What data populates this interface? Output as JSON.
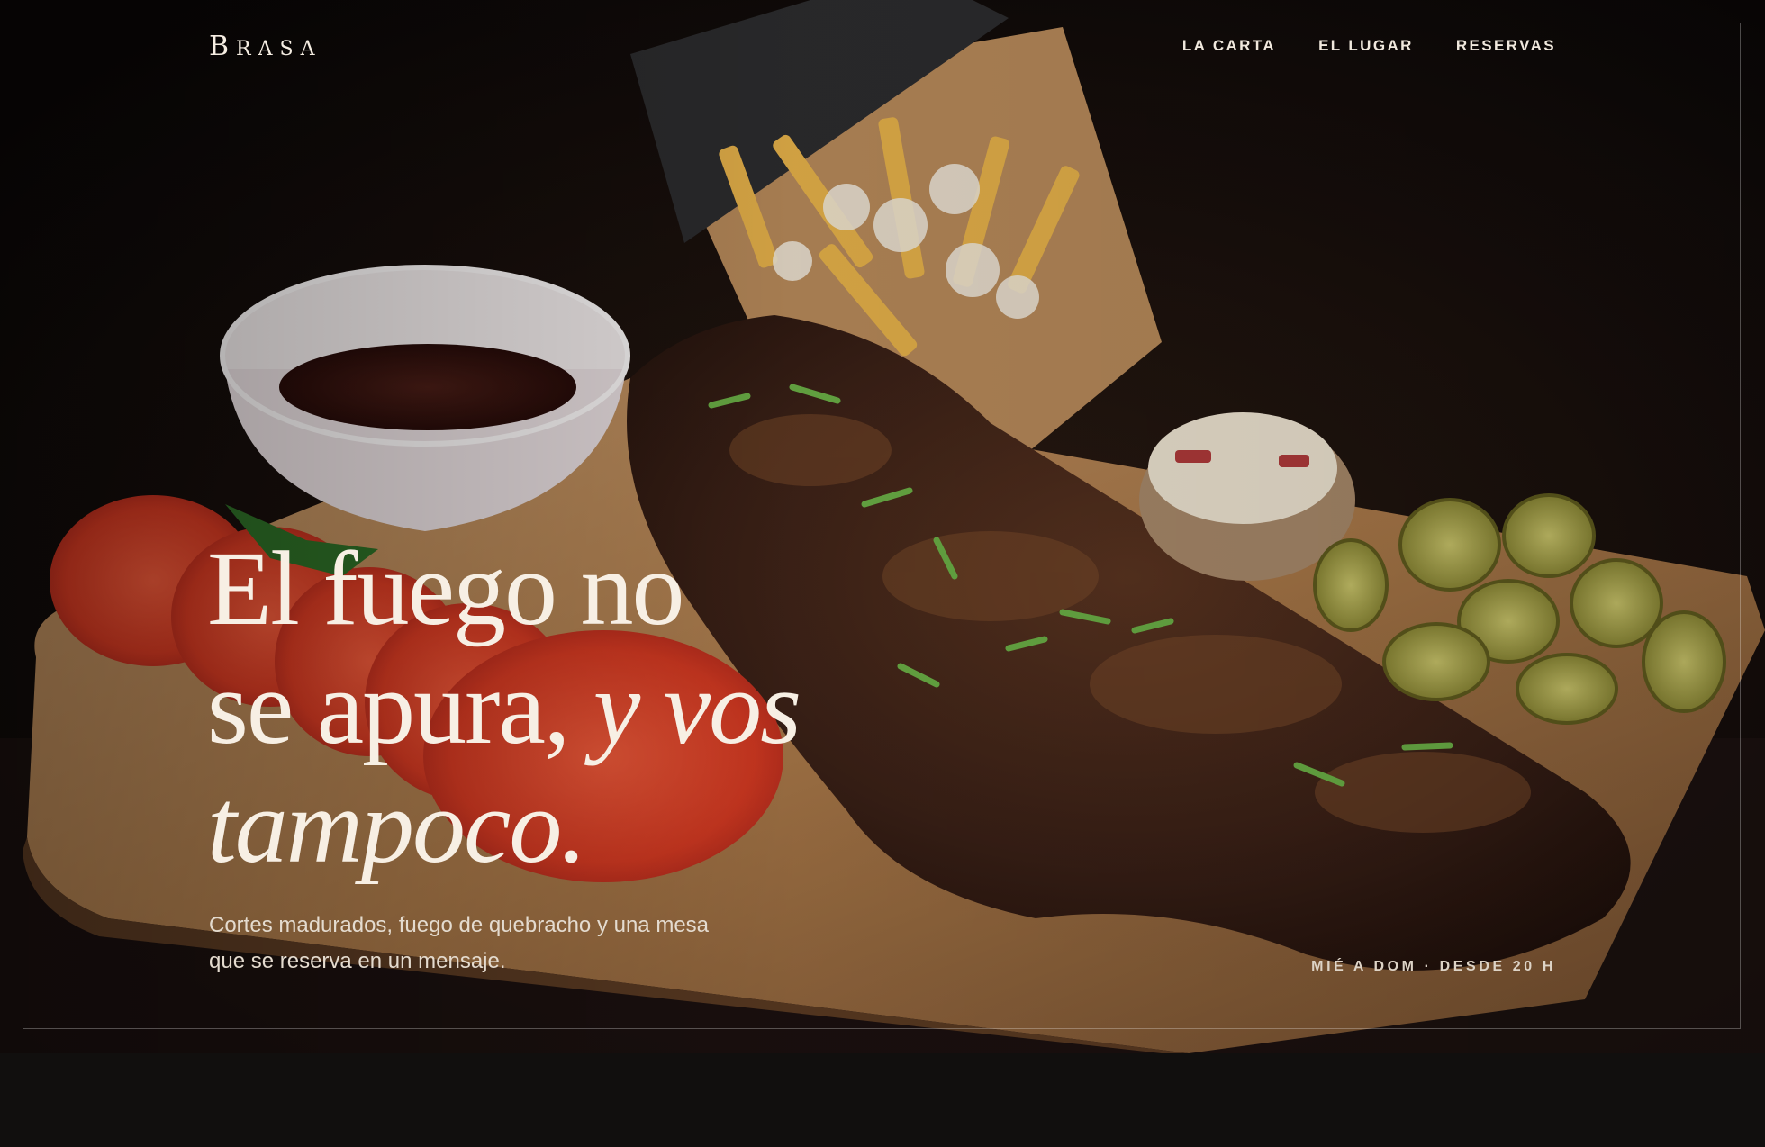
{
  "brand": {
    "initial": "B",
    "rest": "RASA"
  },
  "nav": [
    {
      "label": "LA CARTA"
    },
    {
      "label": "EL LUGAR"
    },
    {
      "label": "RESERVAS"
    }
  ],
  "hero": {
    "headline_line1": "El fuego no",
    "headline_line2": "se apura,",
    "headline_italic": "y vos tampoco.",
    "lead": "Cortes madurados, fuego de quebracho y una mesa que se reserva en un mensaje.",
    "hours": "MIÉ A DOM · DESDE 20 H"
  },
  "colors": {
    "background": "#110f0e",
    "text_cream": "#f7efe4",
    "accent_wood": "#c89a6a"
  }
}
